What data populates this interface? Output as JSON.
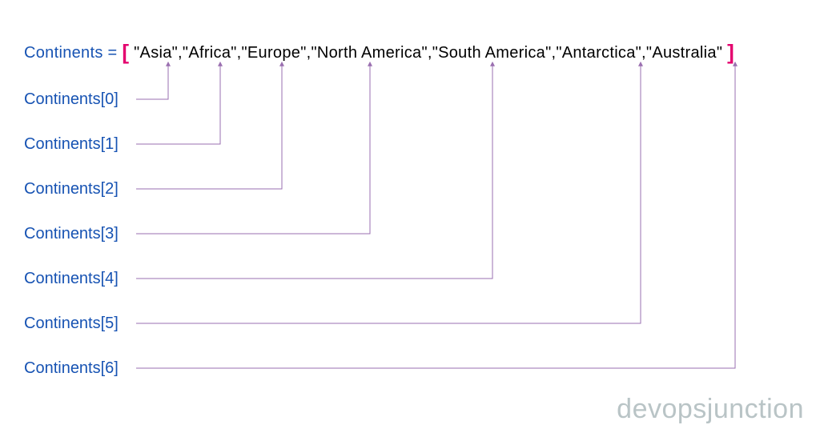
{
  "variable_name": "Continents",
  "assign_symbol": "=",
  "bracket_open": "[",
  "bracket_close": "]",
  "array_items": [
    "Asia",
    "Africa",
    "Europe",
    "North America",
    "South America",
    "Antarctica",
    "Australia"
  ],
  "array_literal_text": "\"Asia\",\"Africa\",\"Europe\",\"North America\",\"South America\",\"Antarctica\",\"Australia\"",
  "index_labels": [
    "Continents[0]",
    "Continents[1]",
    "Continents[2]",
    "Continents[3]",
    "Continents[4]",
    "Continents[5]",
    "Continents[6]"
  ],
  "watermark": "devopsjunction",
  "colors": {
    "variable": "#1753b3",
    "bracket": "#e4006e",
    "text": "#000000",
    "arrow": "#9a6fb0",
    "watermark": "#b9c4c6"
  }
}
